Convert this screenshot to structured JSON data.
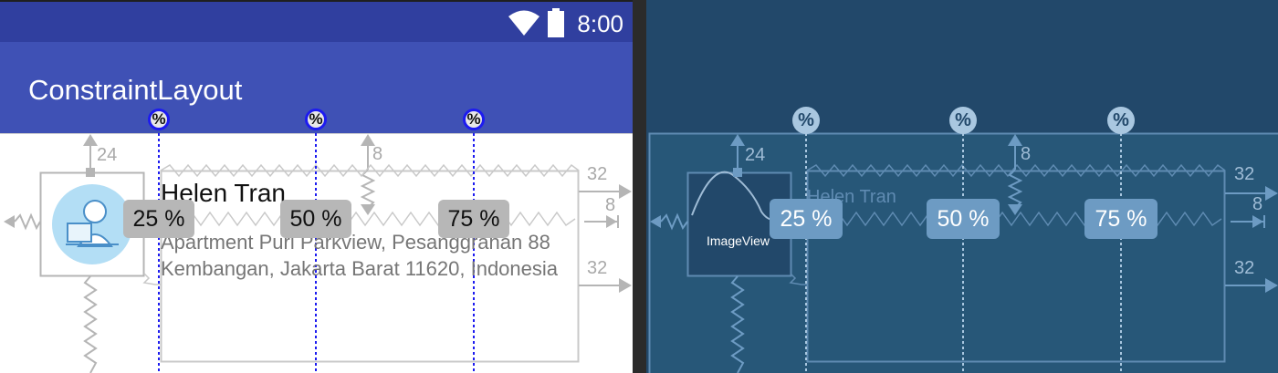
{
  "status_bar": {
    "time": "8:00",
    "wifi_icon": "wifi-icon",
    "battery_icon": "battery-icon"
  },
  "app_bar": {
    "title": "ConstraintLayout"
  },
  "guideline_marker_symbol": "%",
  "guidelines": [
    {
      "percent_label": "25 %",
      "percent": 25
    },
    {
      "percent_label": "50 %",
      "percent": 50
    },
    {
      "percent_label": "75 %",
      "percent": 75
    }
  ],
  "content": {
    "name": "Helen Tran",
    "address": "Apartment Puri Parkview, Pesanggrahan 88 Kembangan, Jakarta Barat 11620, Indonesia"
  },
  "blueprint": {
    "image_view_label": "ImageView",
    "name": "Helen Tran"
  },
  "constraint_margins": {
    "image_top": "24",
    "text_top": "8",
    "name_end": "32",
    "name_end_inner": "8",
    "address_end": "32"
  },
  "colors": {
    "status_bar": "#303f9f",
    "app_bar": "#3f51b5",
    "guideline": "#1d1bf0",
    "blueprint_bg": "#22486a",
    "blueprint_line": "#5f8bb2"
  }
}
